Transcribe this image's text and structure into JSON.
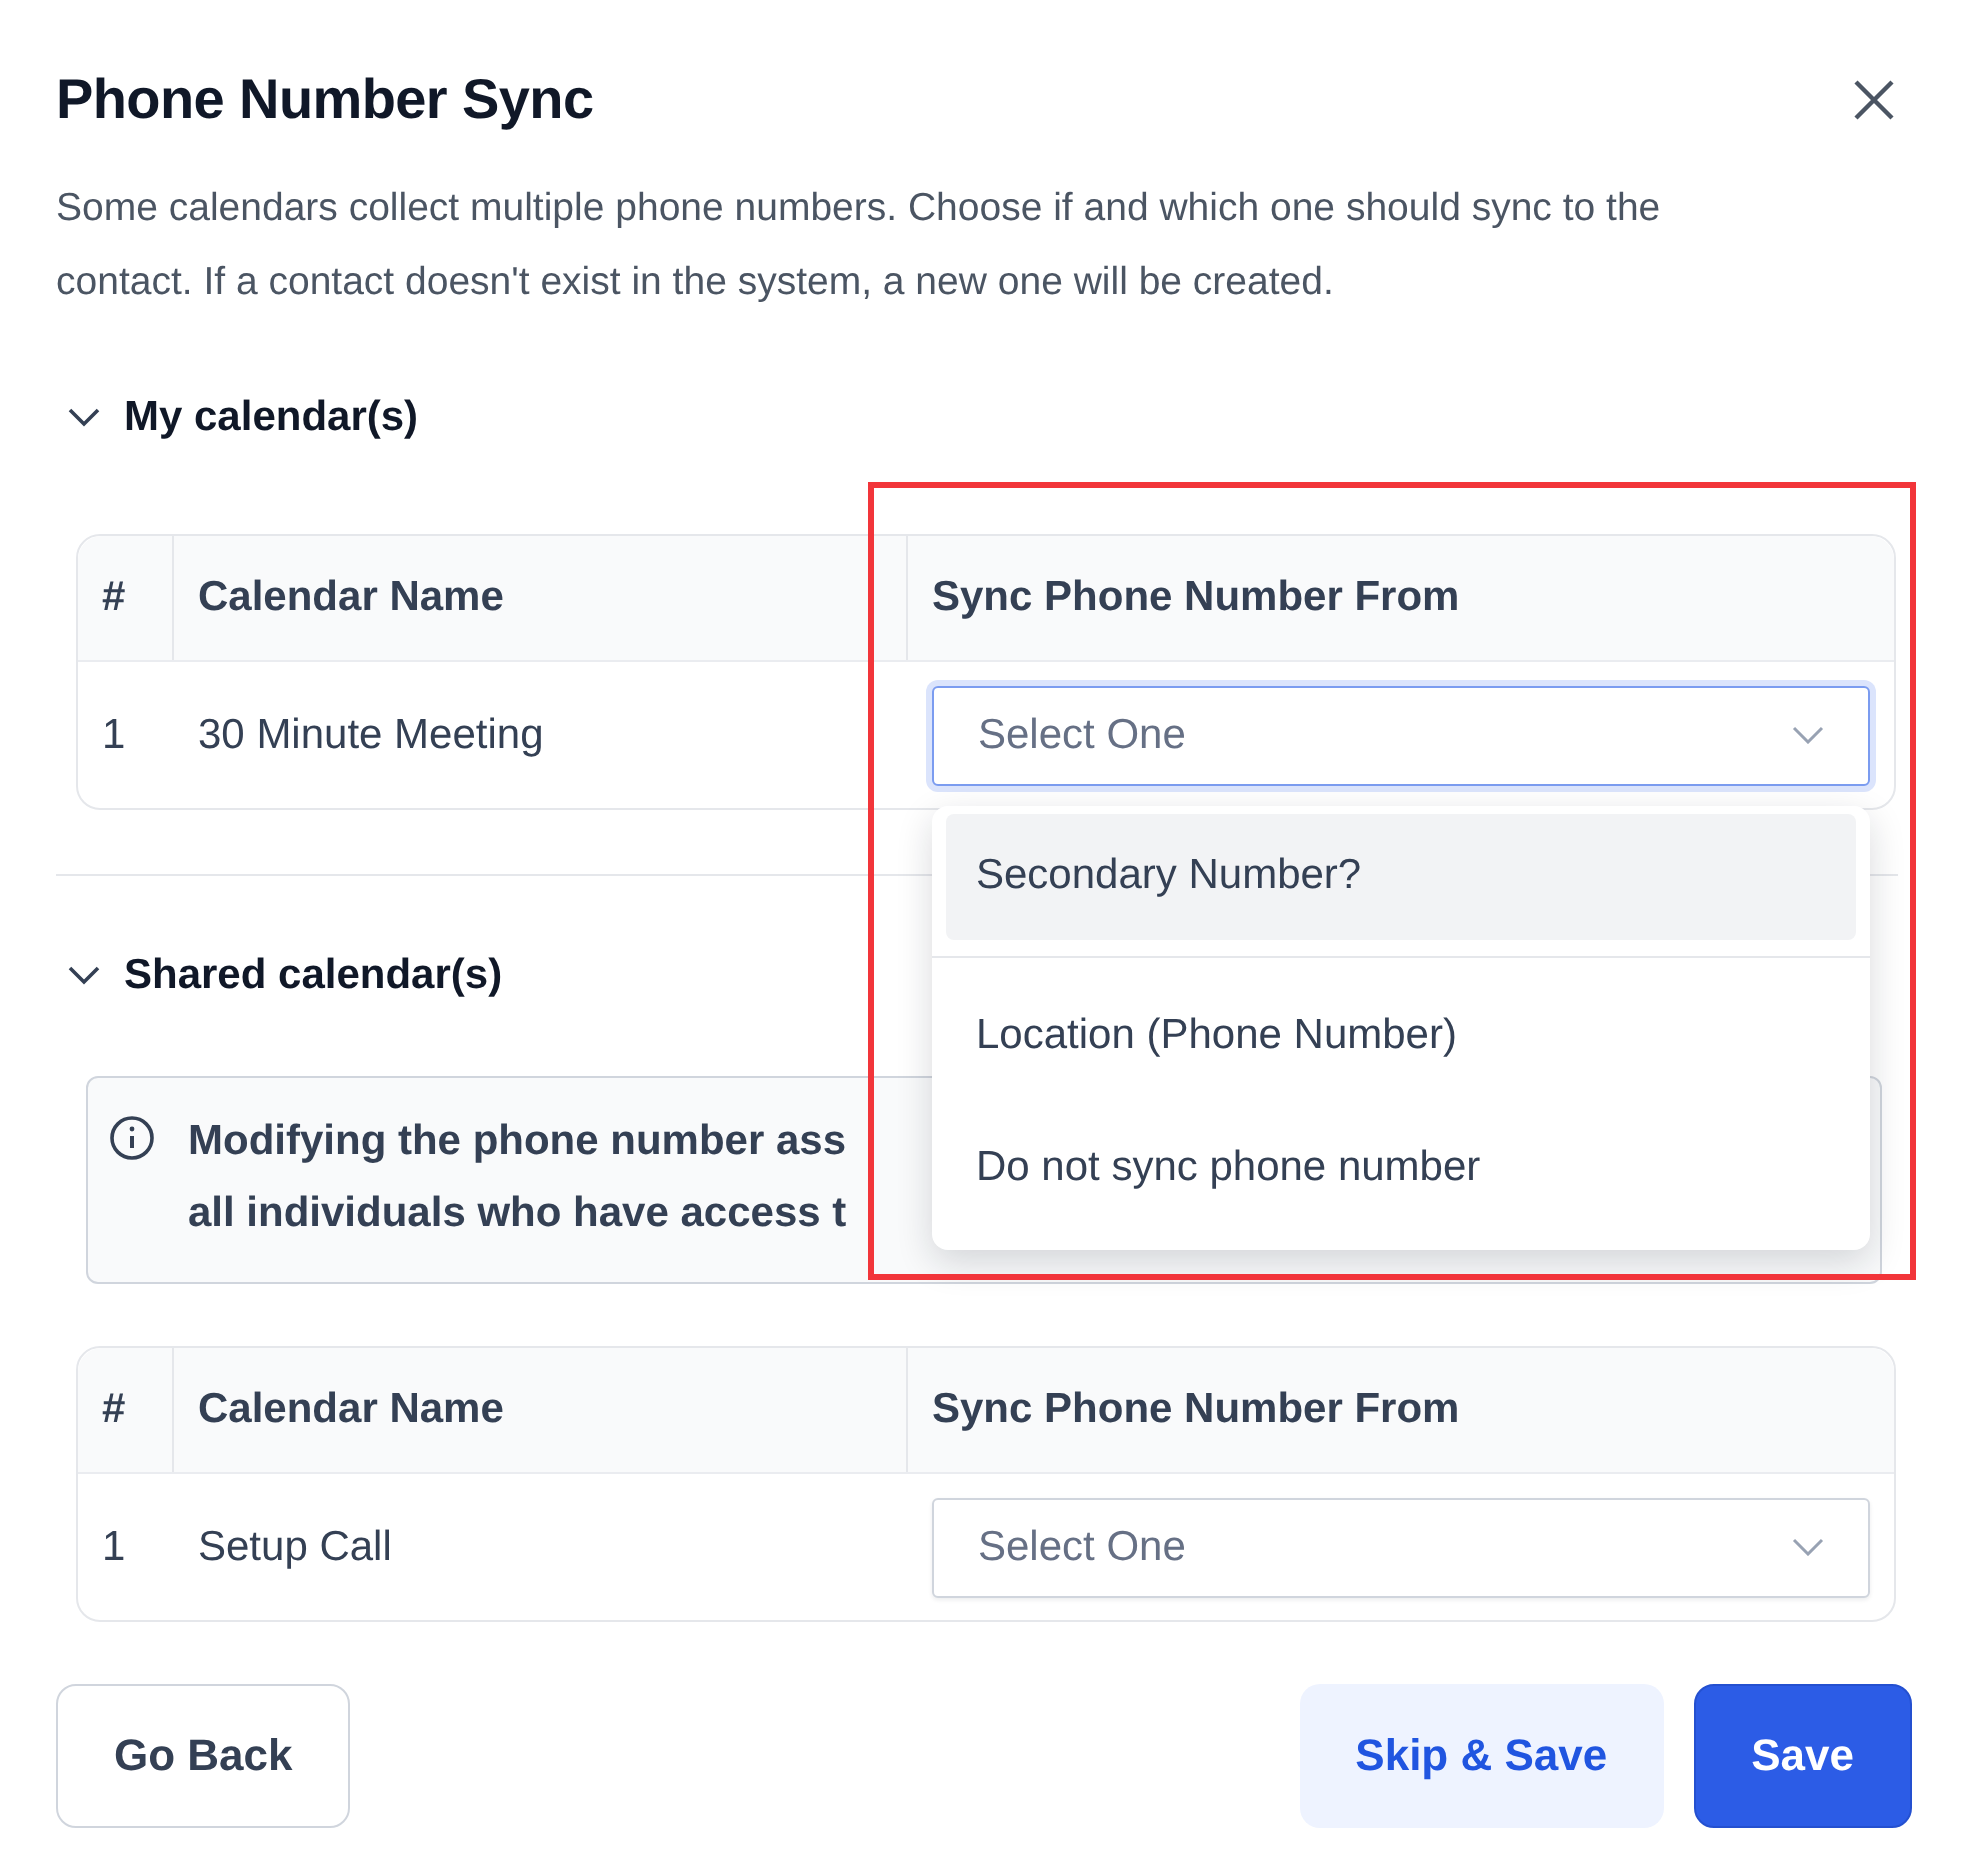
{
  "dialog": {
    "title": "Phone Number Sync",
    "description": "Some calendars collect multiple phone numbers. Choose if and which one should sync to the contact. If a contact doesn't exist in the system, a new one will be created."
  },
  "sections": [
    {
      "title": "My calendar(s)",
      "expanded": true,
      "columns": [
        "#",
        "Calendar Name",
        "Sync Phone Number From"
      ],
      "rows": [
        {
          "index": "1",
          "name": "30 Minute Meeting",
          "select": {
            "placeholder": "Select One",
            "open": true,
            "options": [
              {
                "label": "Secondary Number?",
                "hovered": true
              },
              {
                "label": "Location (Phone Number)",
                "hovered": false
              },
              {
                "label": "Do not sync phone number",
                "hovered": false
              }
            ]
          }
        }
      ]
    },
    {
      "title": "Shared calendar(s)",
      "expanded": true,
      "notice_lines": [
        "Modifying the phone number ass",
        "all individuals who have access t"
      ],
      "columns": [
        "#",
        "Calendar Name",
        "Sync Phone Number From"
      ],
      "rows": [
        {
          "index": "1",
          "name": "Setup Call",
          "select": {
            "placeholder": "Select One",
            "open": false
          }
        }
      ]
    }
  ],
  "buttons": [
    {
      "label": "Go Back",
      "kind": "outline"
    },
    {
      "label": "Skip & Save",
      "kind": "soft"
    },
    {
      "label": "Save",
      "kind": "primary"
    }
  ],
  "highlight_frame": true
}
